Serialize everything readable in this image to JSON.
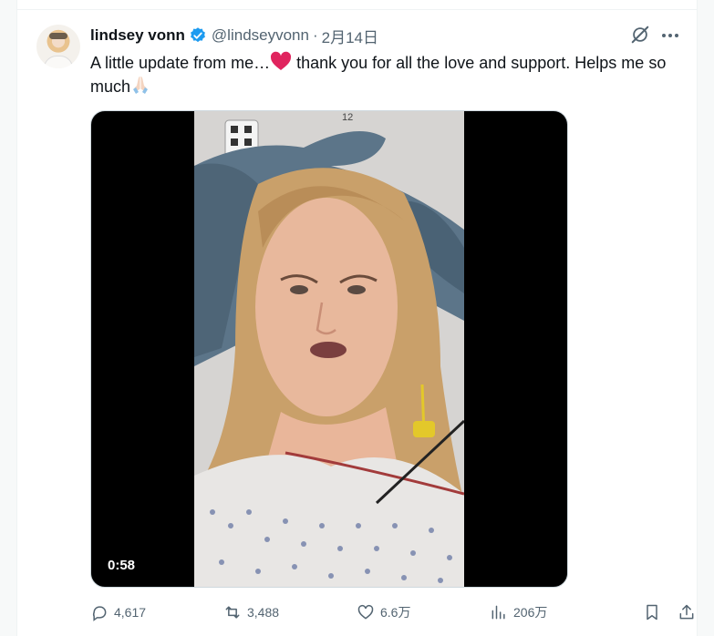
{
  "post": {
    "author_name": "lindsey vonn",
    "author_handle": "@lindseyvonn",
    "separator": "·",
    "date": "2月14日",
    "text_part1": "A little update from me…",
    "text_part2": " thank you for all the love and support. Helps me so much",
    "emoji_1": "heart-emoji",
    "emoji_2": "praying-hands-emoji",
    "verified": "verified-badge-icon"
  },
  "media": {
    "duration": "0:58"
  },
  "actions": {
    "replies": "4,617",
    "reposts": "3,488",
    "likes": "6.6万",
    "views": "206万"
  },
  "colors": {
    "accent": "#1d9bf0",
    "text": "#0f1419",
    "muted": "#536471",
    "heart": "#e0245e"
  }
}
